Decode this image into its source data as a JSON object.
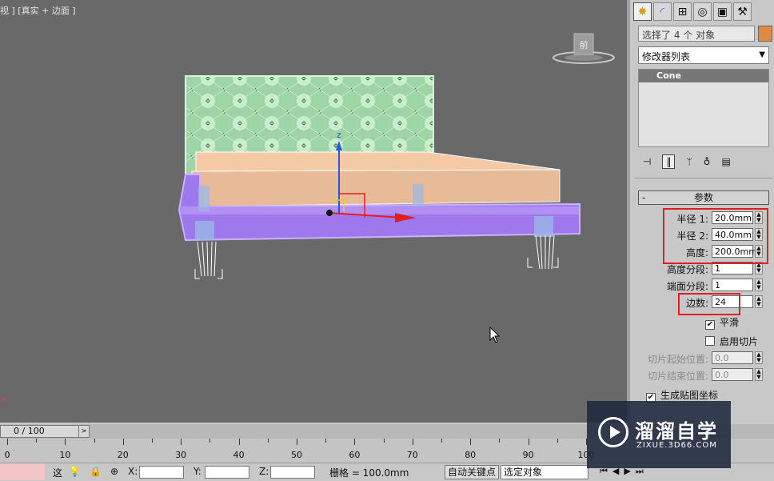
{
  "viewport": {
    "label": "视 ] [真实 + 边面 ]",
    "viewcube_label": "前",
    "axis_z": "z",
    "red_mark": "×"
  },
  "command_panel": {
    "tabs": [
      {
        "icon": "sun-icon",
        "active": true
      },
      {
        "icon": "modify-icon",
        "active": false
      },
      {
        "icon": "hierarchy-icon",
        "active": false
      },
      {
        "icon": "motion-icon",
        "active": false
      },
      {
        "icon": "display-icon",
        "active": false
      },
      {
        "icon": "utilities-hammer-icon",
        "active": false
      }
    ],
    "selection_name": "选择了 4 个 对象",
    "object_color": "#e08a40",
    "modifier_list": "修改器列表",
    "stack_item": "Cone",
    "rollout_minus": "-",
    "rollout_title": "参数",
    "params": {
      "radius1": {
        "label": "半径 1:",
        "value": "20.0mm"
      },
      "radius2": {
        "label": "半径 2:",
        "value": "40.0mm"
      },
      "height": {
        "label": "高度:",
        "value": "200.0mm"
      },
      "height_segs": {
        "label": "高度分段:",
        "value": "1"
      },
      "cap_segs": {
        "label": "端面分段:",
        "value": "1"
      },
      "sides": {
        "label": "边数:",
        "value": "24"
      },
      "smooth": {
        "label": "平滑",
        "checked": true
      },
      "slice_on": {
        "label": "启用切片",
        "checked": false
      },
      "slice_from": {
        "label": "切片起始位置:",
        "value": "0.0"
      },
      "slice_to": {
        "label": "切片结束位置:",
        "value": "0.0"
      },
      "gen_mapping": {
        "label": "生成贴图坐标",
        "checked": true
      }
    },
    "highlight_color": "#e02020"
  },
  "timeline": {
    "position": "0 / 100",
    "ticks": [
      "0",
      "10",
      "20",
      "30",
      "40",
      "50",
      "60",
      "70",
      "80",
      "90",
      "100"
    ]
  },
  "statusbar": {
    "select_label": "这",
    "x_label": "X:",
    "y_label": "Y:",
    "z_label": "Z:",
    "grid": "栅格 = 100.0mm",
    "auto_key": "自动关键点",
    "selected_set": "选定对象"
  },
  "watermark": {
    "title": "溜溜自学",
    "subtitle": "ZIXUE.3D66.COM"
  }
}
